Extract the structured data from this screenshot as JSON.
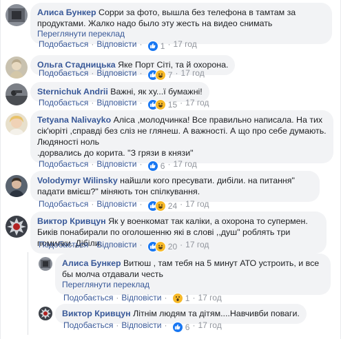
{
  "labels": {
    "like": "Подобається",
    "reply": "Відповісти",
    "translate": "Переглянути переклад"
  },
  "colors": {
    "link": "#385898",
    "bubble": "#f2f3f5",
    "like_badge": "#1877f2",
    "emoji_badge": "#f7b928"
  },
  "comments": [
    {
      "author": "Алиса Бункер",
      "text": "Сорри за фото, вышла без телефона в тамтам за продуктами. Жалко надо было эту жесть на видео снимать",
      "translate": "Переглянути переклад",
      "reactions": [
        "like-icon"
      ],
      "count": "1",
      "time": "17 год"
    },
    {
      "author": "Ольга Стадницька",
      "text": "Яке Порт Сіті, та й охорона.",
      "reactions": [
        "like-icon",
        "haha-icon"
      ],
      "count": "7",
      "time": "17 год"
    },
    {
      "author": "Sternichuk Andrii",
      "text": "Важні, як ху...ї бумажні!",
      "reactions": [
        "like-icon",
        "haha-icon"
      ],
      "count": "15",
      "time": "17 год"
    },
    {
      "author": "Tetyana Nalivayko",
      "text_lines": [
        "Аліса ,молодчинка! Все правильно написала. На тих",
        "сік'юріті ,справді без сліз не глянеш. А важності. А що про себе думають.",
        "Людяності ноль",
        ".дорвались до корита. \"З грязи в князи\""
      ],
      "reactions": [
        "like-icon"
      ],
      "count": "6",
      "time": "17 год"
    },
    {
      "author": "Volodymyr Wilinsky",
      "text": "найшли кого пресувати. дибіли. на питання\" падати вмієш?\" міняють тон спілкування.",
      "reactions": [
        "like-icon",
        "haha-icon"
      ],
      "count": "24",
      "time": "17 год"
    },
    {
      "author": "Виктор Кривцун",
      "text": "Як у военкомат так каліки, а охорона то супермен. Биків понабирали по оголошенню які в слові ,,душ\" роблять три помилки. Дібіли.",
      "reactions": [
        "like-icon",
        "haha-icon"
      ],
      "count": "20",
      "time": "17 год"
    }
  ],
  "replies": [
    {
      "author": "Алиса Бункер",
      "text": "Витюш , там тебя на 5 минут АТО устроить, и все бы молча отдавали честь",
      "translate": "Переглянути переклад",
      "reactions": [
        "wow-icon"
      ],
      "count": "1",
      "time": "17 год"
    },
    {
      "author": "Виктор Кривцун",
      "text": "Літнім людям та дітям....Навчивби поваги.",
      "reactions": [
        "like-icon"
      ],
      "count": "6",
      "time": "17 год"
    }
  ]
}
